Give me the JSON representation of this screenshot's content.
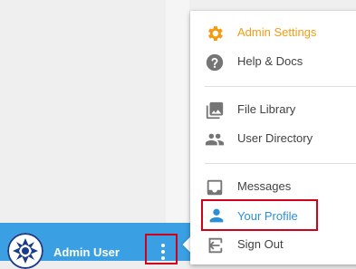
{
  "user": {
    "name": "Admin User"
  },
  "menu": {
    "items": [
      {
        "name": "admin-settings",
        "label": "Admin Settings",
        "icon": "gear-icon"
      },
      {
        "name": "help-docs",
        "label": "Help & Docs",
        "icon": "help-icon"
      },
      {
        "name": "file-library",
        "label": "File Library",
        "icon": "image-library-icon"
      },
      {
        "name": "user-directory",
        "label": "User Directory",
        "icon": "people-icon"
      },
      {
        "name": "messages",
        "label": "Messages",
        "icon": "inbox-icon"
      },
      {
        "name": "your-profile",
        "label": "Your Profile",
        "icon": "person-icon"
      },
      {
        "name": "sign-out",
        "label": "Sign Out",
        "icon": "sign-out-icon"
      }
    ]
  },
  "colors": {
    "footer_blue": "#3b9fe3",
    "accent_orange": "#f59b12",
    "selected_blue": "#2b8fd6",
    "highlight_red": "#d0021b"
  }
}
